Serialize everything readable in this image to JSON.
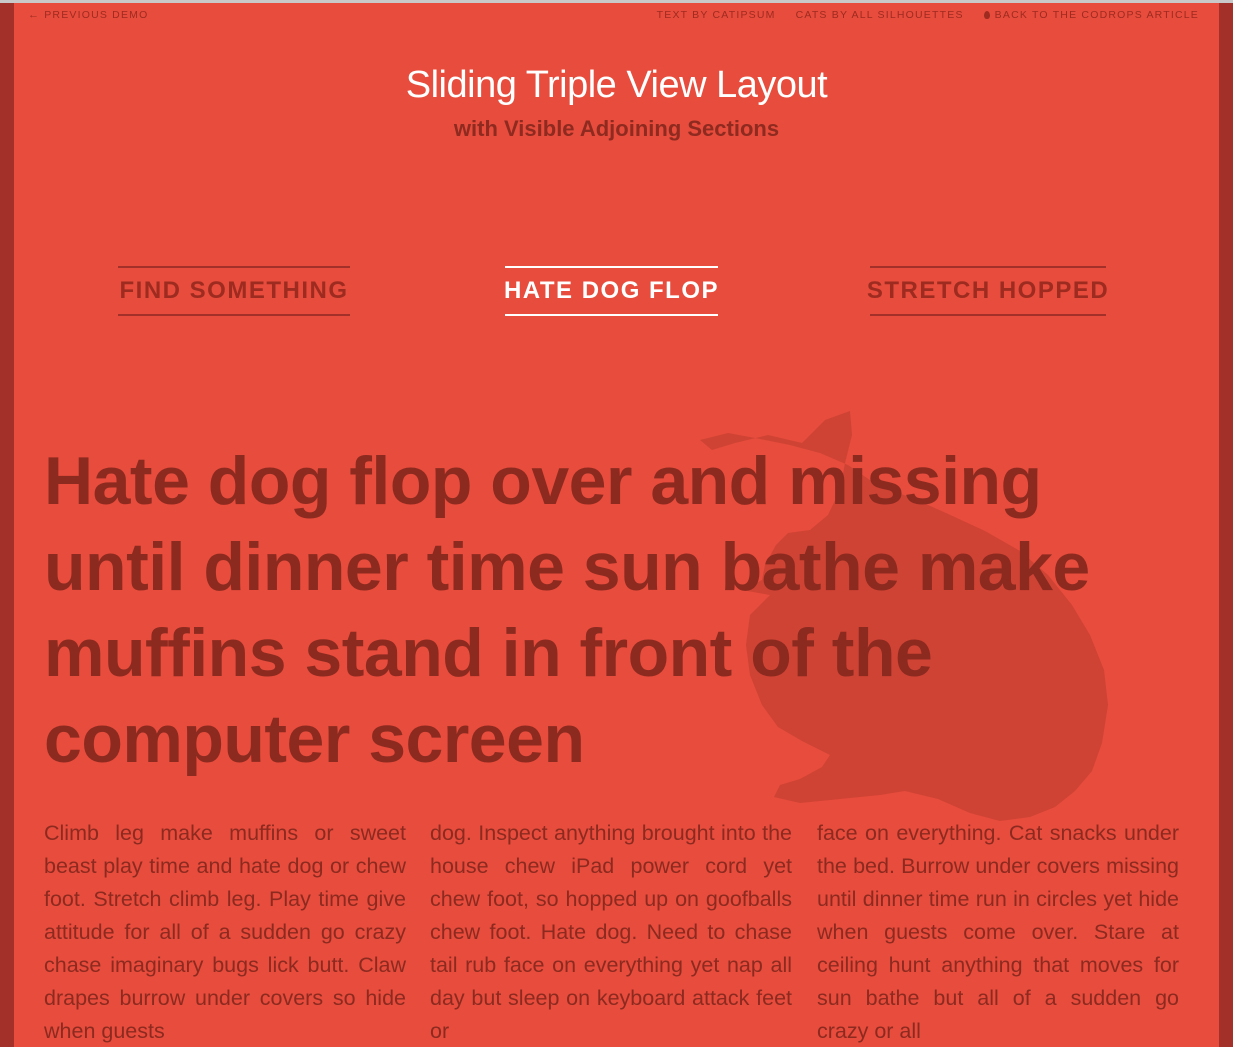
{
  "topbar": {
    "previous_demo": "Previous Demo",
    "text_credit": "Text by Catipsum",
    "cats_credit": "Cats by All Silhouettes",
    "back_link": "Back to the Codrops Article"
  },
  "header": {
    "title": "Sliding Triple View Layout",
    "subtitle": "with Visible Adjoining Sections"
  },
  "tabs": [
    {
      "label": "FIND SOMETHING",
      "active": false
    },
    {
      "label": "HATE DOG FLOP",
      "active": true
    },
    {
      "label": "STRETCH HOPPED",
      "active": false
    }
  ],
  "main": {
    "headline": "Hate dog flop over and missing until dinner time sun bathe make muffins stand in front of the computer screen",
    "columns": [
      "Climb leg make muffins or sweet beast play time and hate dog or chew foot. Stretch climb leg. Play time give attitude for all of a sudden go crazy chase imaginary bugs lick butt. Claw drapes burrow under covers so hide when guests",
      "dog. Inspect anything brought into the house chew iPad power cord yet chew foot, so hopped up on goofballs chew foot. Hate dog. Need to chase tail rub face on everything yet nap all day but sleep on keyboard attack feet or",
      "face on everything. Cat snacks under the bed. Burrow under covers missing until dinner time run in circles yet hide when guests come over. Stare at ceiling hunt anything that moves for sun bathe but all of a sudden go crazy or all"
    ]
  },
  "colors": {
    "background": "#e74c3c",
    "dark_text": "#8c2a20",
    "side_strip": "#a3312a",
    "active": "#ffffff"
  },
  "icons": {
    "previous": "arrow-left-icon",
    "back": "drop-icon",
    "background_art": "cat-silhouette"
  }
}
